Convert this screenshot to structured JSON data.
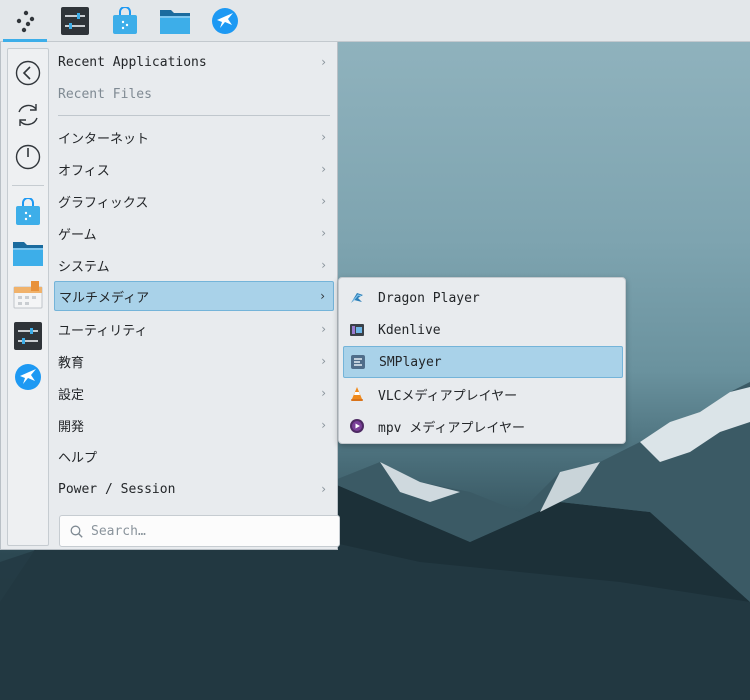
{
  "panel": {
    "items": [
      {
        "name": "app-launcher",
        "icon": "launcher-dots-icon"
      },
      {
        "name": "system-settings",
        "icon": "settings-sliders-icon"
      },
      {
        "name": "discover",
        "icon": "shopping-bag-icon"
      },
      {
        "name": "dolphin",
        "icon": "folder-icon"
      },
      {
        "name": "browser",
        "icon": "falkon-icon"
      }
    ]
  },
  "sidebar": {
    "actions": [
      "back-arrow-icon",
      "refresh-icon",
      "power-icon"
    ],
    "favorites": [
      "shopping-bag-icon",
      "folder-icon",
      "calendar-icon",
      "settings-sliders-icon",
      "falkon-icon"
    ]
  },
  "menu": {
    "recent_applications": "Recent Applications",
    "recent_files": "Recent Files",
    "categories": [
      {
        "label": "インターネット"
      },
      {
        "label": "オフィス"
      },
      {
        "label": "グラフィックス"
      },
      {
        "label": "ゲーム"
      },
      {
        "label": "システム"
      },
      {
        "label": "マルチメディア"
      },
      {
        "label": "ユーティリティ"
      },
      {
        "label": "教育"
      },
      {
        "label": "設定"
      },
      {
        "label": "開発"
      },
      {
        "label": "ヘルプ"
      },
      {
        "label": "Power / Session"
      }
    ],
    "selected_category": "マルチメディア",
    "search_placeholder": "Search…"
  },
  "submenu": {
    "items": [
      {
        "label": "Dragon Player",
        "icon": "dragon-player-icon"
      },
      {
        "label": "Kdenlive",
        "icon": "kdenlive-icon"
      },
      {
        "label": "SMPlayer",
        "icon": "smplayer-icon"
      },
      {
        "label": "VLCメディアプレイヤー",
        "icon": "vlc-cone-icon"
      },
      {
        "label": "mpv メディアプレイヤー",
        "icon": "mpv-icon"
      }
    ],
    "selected": "SMPlayer"
  },
  "colors": {
    "accent": "#3daee9",
    "highlight": "#a9d2e9",
    "panel": "#e3e7ea",
    "menu_bg": "#e8ebee"
  }
}
